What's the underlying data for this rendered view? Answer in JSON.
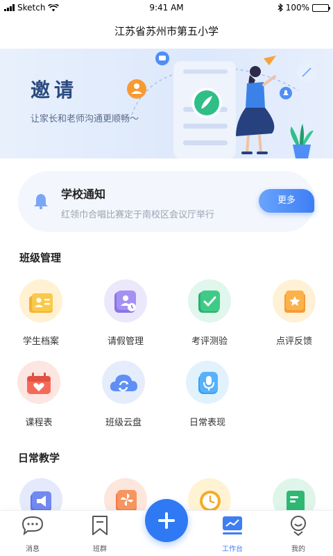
{
  "status_bar": {
    "carrier": "Sketch",
    "time": "9:41 AM",
    "battery": "100%"
  },
  "header": {
    "title": "江苏省苏州市第五小学"
  },
  "banner": {
    "title": "邀请",
    "subtitle": "让家长和老师沟通更顺畅～"
  },
  "notice": {
    "title": "学校通知",
    "text": "红领巾合唱比赛定于南校区会议厅举行",
    "more_label": "更多"
  },
  "class_management": {
    "title": "班级管理",
    "items": [
      {
        "label": "学生档案",
        "icon": "student-file-icon"
      },
      {
        "label": "请假管理",
        "icon": "leave-management-icon"
      },
      {
        "label": "考评测验",
        "icon": "exam-icon"
      },
      {
        "label": "点评反馈",
        "icon": "feedback-star-icon"
      },
      {
        "label": "课程表",
        "icon": "calendar-icon"
      },
      {
        "label": "班级云盘",
        "icon": "cloud-sync-icon"
      },
      {
        "label": "日常表现",
        "icon": "microphone-icon"
      }
    ]
  },
  "daily_teaching": {
    "title": "日常教学",
    "items": [
      {
        "icon": "megaphone-icon"
      },
      {
        "icon": "pinwheel-icon"
      },
      {
        "icon": "clock-icon"
      },
      {
        "icon": "notebook-icon"
      }
    ]
  },
  "tabbar": {
    "tabs": [
      {
        "label": "消息",
        "icon": "message-icon"
      },
      {
        "label": "班群",
        "icon": "bookmark-icon"
      },
      {
        "label": "工作台",
        "icon": "workbench-icon",
        "active": true
      },
      {
        "label": "我的",
        "icon": "profile-icon"
      }
    ],
    "fab_icon": "plus-icon"
  },
  "colors": {
    "accent": "#3d7ef5",
    "banner_title": "#2a4a80",
    "text_muted": "#9aa3b3"
  }
}
